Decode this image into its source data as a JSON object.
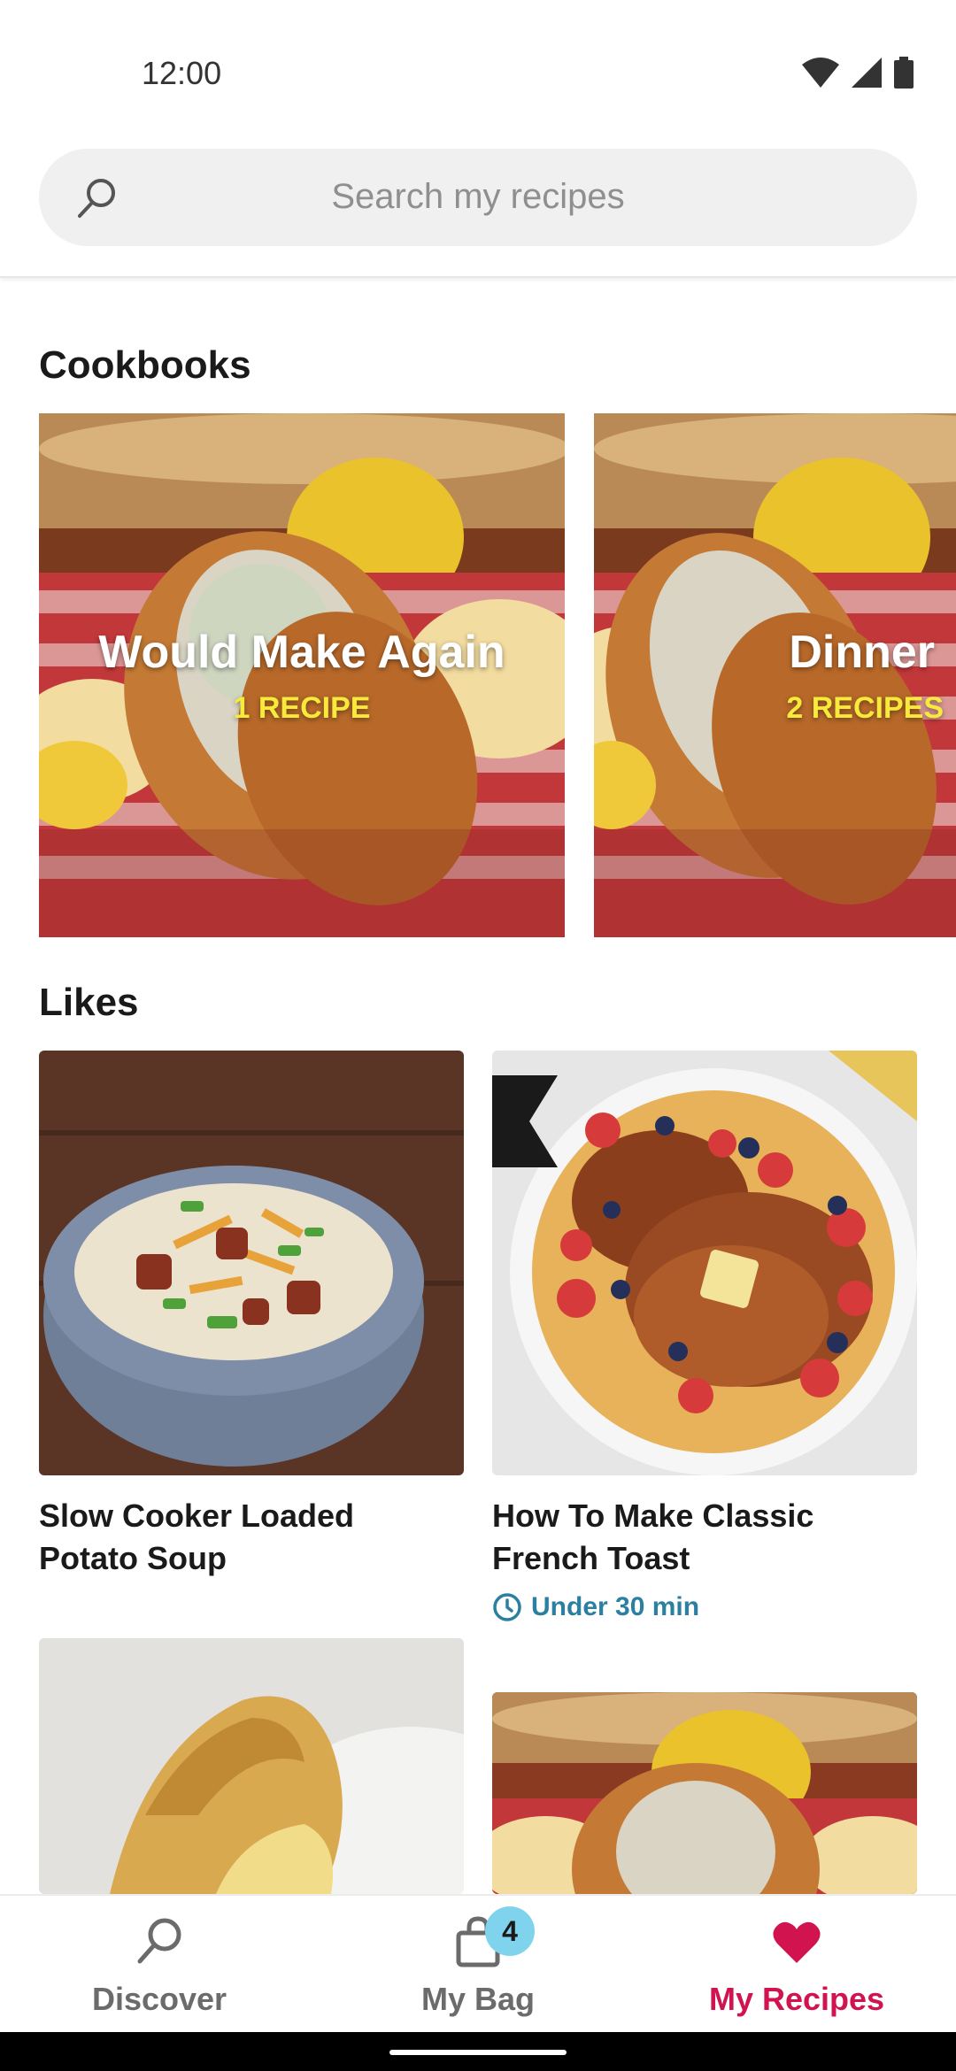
{
  "status_bar": {
    "time": "12:00"
  },
  "search": {
    "placeholder": "Search my recipes"
  },
  "cookbooks": {
    "title": "Cookbooks",
    "items": [
      {
        "name": "Would Make Again",
        "count": "1 RECIPE"
      },
      {
        "name": "Dinner",
        "count": "2 RECIPES"
      }
    ]
  },
  "likes": {
    "title": "Likes",
    "items": [
      {
        "title_line1": "Slow Cooker Loaded",
        "title_line2": "Potato Soup"
      },
      {
        "title_line1": "How To Make Classic",
        "title_line2": "French Toast",
        "meta": "Under 30 min"
      }
    ]
  },
  "bottom_nav": {
    "items": [
      {
        "label": "Discover",
        "icon": "search-icon"
      },
      {
        "label": "My Bag",
        "icon": "bag-icon",
        "badge": "4"
      },
      {
        "label": "My Recipes",
        "icon": "heart-icon",
        "active": true
      }
    ]
  },
  "colors": {
    "accent": "#d11450",
    "badge": "#7fd3ec",
    "cookbook_count": "#f8ea3a",
    "meta": "#2b7fa0"
  }
}
